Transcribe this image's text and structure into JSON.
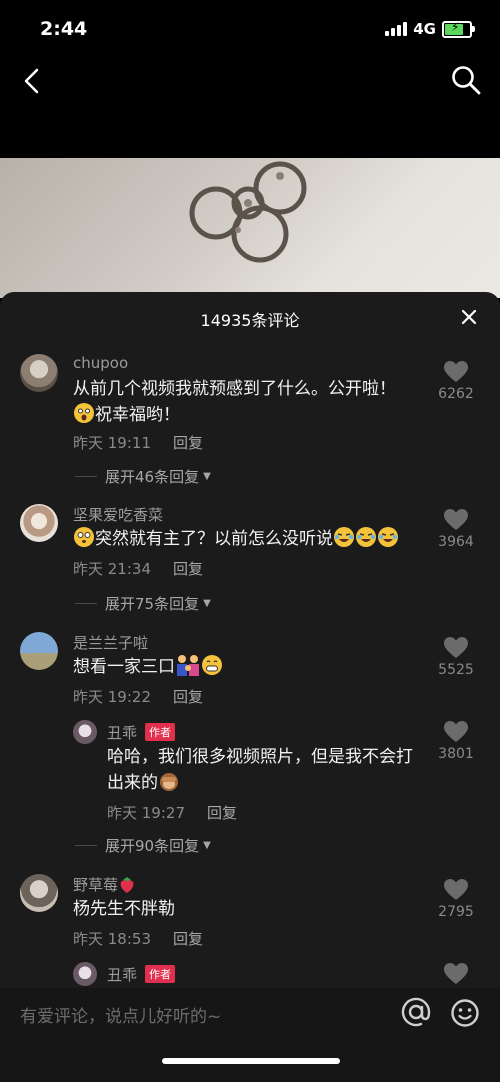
{
  "status_bar": {
    "time": "2:44",
    "network": "4G",
    "battery_color": "#5cd65c"
  },
  "nav": {
    "back_icon": "chevron-left-icon",
    "search_icon": "search-icon"
  },
  "panel": {
    "title": "14935条评论",
    "close_icon": "close-icon"
  },
  "comments": [
    {
      "user": "chupoo",
      "text_line1": "从前几个视频我就预感到了什么。公开啦！",
      "text_line2": "祝幸福哟！",
      "time": "昨天 19:11",
      "reply_label": "回复",
      "likes": "6262",
      "expand": "展开46条回复"
    },
    {
      "user": "坚果爱吃香菜",
      "text": "突然就有主了？以前怎么没听说",
      "time": "昨天 21:34",
      "reply_label": "回复",
      "likes": "3964",
      "expand": "展开75条回复"
    },
    {
      "user": "是兰兰子啦",
      "text": "想看一家三口",
      "time": "昨天 19:22",
      "reply_label": "回复",
      "likes": "5525"
    },
    {
      "user": "野草莓",
      "text": "杨先生不胖勒",
      "time": "昨天 18:53",
      "reply_label": "回复",
      "likes": "2795"
    }
  ],
  "replies": [
    {
      "user": "丑乖",
      "tag": "作者",
      "text_line1": "哈哈，我们很多视频照片，但是我不会打",
      "text_line2": "出来的",
      "time": "昨天 19:27",
      "reply_label": "回复",
      "likes": "3801",
      "expand": "展开90条回复"
    },
    {
      "user": "丑乖",
      "tag": "作者"
    }
  ],
  "input": {
    "placeholder": "有爱评论，说点儿好听的~",
    "at_icon": "at-icon",
    "emoji_icon": "emoji-icon"
  },
  "colors": {
    "panel_bg": "#1b1b1b",
    "author_tag": "#e0304e",
    "meta_text": "#8a8a8a"
  }
}
